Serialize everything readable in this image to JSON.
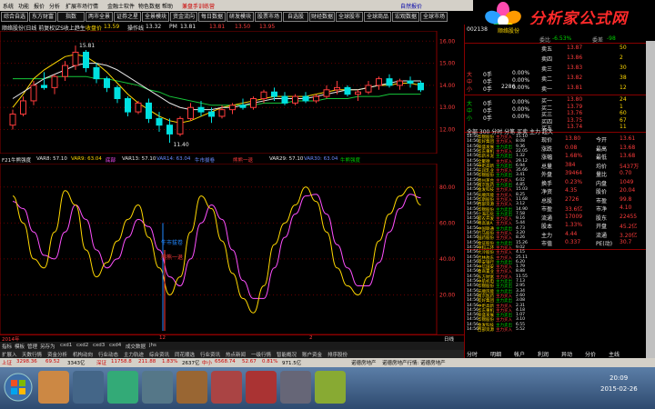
{
  "menu": [
    "系统",
    "功能",
    "报价",
    "分析",
    "扩展市场行情",
    "金融士软件",
    "物色数据",
    "帮助",
    "兼盘手训练营",
    "自然报价"
  ],
  "toolbar": [
    "综合自选",
    "东方财富",
    "指数",
    "两市全景",
    "证券之星",
    "全景模块",
    "资金流向",
    "每日数据",
    "研发模块",
    "股票市场",
    "自选股",
    "财经数据",
    "全球股市",
    "全球商品",
    "宏观数据",
    "全球市场"
  ],
  "stock": {
    "name": "顺络股份(日线 前复权)",
    "ma_label": "ZS收上趋生",
    "close_label": "收盘价",
    "close_val": "13.59",
    "ma2_label": "操作线",
    "ma2_val": "13.32",
    "pm_label": "PM",
    "pm_val": "13.81",
    "ma3_val": "13.81",
    "ma4_val": "13.50",
    "ma5_val": "13.95"
  },
  "main_axis": [
    "16.00",
    "15.00",
    "14.00",
    "13.00",
    "12.00"
  ],
  "annotations": {
    "high": "15.81",
    "low": "11.40"
  },
  "indicator": {
    "name": "F21牛熊强度",
    "v1": "VAR8: 57.10",
    "v2": "VAR9: 63.04",
    "v3": "底部",
    "v4": "VAR13: 57.10",
    "v5": "VAR14: 63.04",
    "v6": "牛市拔卷",
    "v7": "熊熊一退",
    "v8": "VAR29: 57.10",
    "v9": "VAR30: 63.04",
    "v10": "牛熊强度"
  },
  "sub_axis": [
    "80.00",
    "60.00",
    "40.00",
    "20.00"
  ],
  "sub_labels": {
    "a": "牛市拔卷",
    "b": "熊熊一退"
  },
  "datebar": {
    "left": "2014年",
    "m1": "12",
    "m2": "2",
    "right": "日线"
  },
  "tabs1": [
    "指标",
    "模板",
    "管理",
    "另存为",
    "cxd1",
    "cxd2",
    "cxd3",
    "cxd4",
    "成交数据",
    "jhs"
  ],
  "tabs2": [
    "扩展入",
    "天数行情",
    "资金分析",
    "机构动向",
    "行业动态",
    "主力轨迹",
    "综合资讯",
    "同花顺选",
    "行业资讯",
    "热点新闻",
    "一级行情",
    "智能概况",
    "账户资金",
    "排序股份"
  ],
  "rp": {
    "title": "顺络股份",
    "code": "002138",
    "committee": "委比",
    "committee_v": "-6.53%",
    "committee_diff": "委差",
    "committee_dv": "-98",
    "sell": [
      [
        "卖五",
        "13.87",
        "50"
      ],
      [
        "卖四",
        "13.86",
        "2"
      ],
      [
        "卖三",
        "13.83",
        "30"
      ],
      [
        "卖二",
        "13.82",
        "38"
      ],
      [
        "卖一",
        "13.81",
        "12"
      ]
    ],
    "buy": [
      [
        "买一",
        "13.80",
        "24"
      ],
      [
        "买二",
        "13.79",
        "1"
      ],
      [
        "买三",
        "13.76",
        "60"
      ],
      [
        "买四",
        "13.75",
        "67"
      ],
      [
        "买五",
        "13.74",
        "11"
      ]
    ],
    "mid": [
      [
        "大",
        "0手",
        "0.00%"
      ],
      [
        "中",
        "0手",
        "0.00%"
      ],
      [
        "小",
        "0手",
        "0.00%"
      ]
    ],
    "mid2": [
      [
        "大",
        "0手",
        "0.00%"
      ],
      [
        "中",
        "0手",
        "0.00%"
      ],
      [
        "小",
        "0手",
        "0.00%"
      ]
    ],
    "mid_extra": "2286",
    "stats_left": [
      [
        "现价",
        "13.80"
      ],
      [
        "涨跌",
        "0.08"
      ],
      [
        "涨幅",
        "1.68%"
      ],
      [
        "总量",
        "384"
      ],
      [
        "外盘",
        "39464"
      ],
      [
        "换手",
        "0.23%"
      ],
      [
        "净资",
        "4.35"
      ],
      [
        "总股",
        "2726"
      ],
      [
        "市盈",
        "33.6亿"
      ],
      [
        "流通",
        "17009"
      ],
      [
        "股本",
        "1.33%"
      ],
      [
        "主力",
        "4.44"
      ],
      [
        "市值",
        "0.337"
      ]
    ],
    "stats_right": [
      [
        "今开",
        "13.61"
      ],
      [
        "最高",
        "13.68"
      ],
      [
        "最低",
        "13.68"
      ],
      [
        "均价",
        "5437万"
      ],
      [
        "量比",
        "0.70"
      ],
      [
        "内盘",
        "1049"
      ],
      [
        "股价",
        "20.04"
      ],
      [
        "市盈",
        "99.8"
      ],
      [
        "市净",
        "4.10"
      ],
      [
        "股东",
        "22455"
      ],
      [
        "开盘",
        "45.2亿"
      ],
      [
        "流通",
        "3.20亿"
      ],
      [
        "PE(动)",
        "30.7"
      ]
    ],
    "ticks_head": "全部 300 分时 分笔 买卖 主力 超大",
    "ticks": [
      [
        "14:56",
        "华锦股份",
        "主力买入",
        "15.10"
      ],
      [
        "14:56",
        "友好集团",
        "主力买入",
        "8.08"
      ],
      [
        "14:56",
        "荣盛发展",
        "主力卖出",
        "9.36"
      ],
      [
        "14:56",
        "华东重机",
        "主力买入",
        "22.05"
      ],
      [
        "14:56",
        "华新水泥",
        "主力卖出",
        "1.32"
      ],
      [
        "14:56",
        "全聚德",
        "主力买入",
        "29.12"
      ],
      [
        "14:56",
        "中炬高新",
        "主力卖出",
        "6.94"
      ],
      [
        "14:56",
        "天润乳业",
        "主力买入",
        "35.66"
      ],
      [
        "14:56",
        "华锦股份",
        "主力卖出",
        "3.41"
      ],
      [
        "14:56",
        "贵州茅台",
        "主力买入",
        "6.02"
      ],
      [
        "14:56",
        "南京医药",
        "主力卖出",
        "4.85"
      ],
      [
        "14:56",
        "金发科技",
        "主力买入",
        "15.03"
      ],
      [
        "14:56",
        "天顺风能",
        "主力买入",
        "8.25"
      ],
      [
        "14:56",
        "华斯股份",
        "主力买入",
        "11.68"
      ],
      [
        "14:56",
        "西部资源",
        "主力买入",
        "3.12"
      ],
      [
        "14:56",
        "华锦股份",
        "主力卖出",
        "14.90"
      ],
      [
        "14:56",
        "上海石化",
        "主力卖出",
        "7.58"
      ],
      [
        "14:56",
        "新农开发",
        "主力买入",
        "9.16"
      ],
      [
        "14:56",
        "粤高速A",
        "主力买入",
        "5.44"
      ],
      [
        "14:56",
        "中国联通",
        "主力卖出",
        "4.73"
      ],
      [
        "14:56",
        "万马股份",
        "主力买入",
        "3.20"
      ],
      [
        "14:56",
        "国药股份",
        "主力买入",
        "8.26"
      ],
      [
        "14:56",
        "金证股份",
        "主力卖出",
        "15.26"
      ],
      [
        "14:56",
        "中科三环",
        "主力买入",
        "9.02"
      ],
      [
        "14:56",
        "大冷股份",
        "主力买入",
        "4.15"
      ],
      [
        "14:56",
        "吉林敖东",
        "主力买入",
        "25.11"
      ],
      [
        "14:56",
        "平安银行",
        "主力卖出",
        "6.20"
      ],
      [
        "14:56",
        "中信国安",
        "主力买入",
        "1.79"
      ],
      [
        "14:56",
        "鲁商置业",
        "主力买入",
        "8.88"
      ],
      [
        "14:56",
        "东方财富",
        "主力买入",
        "11.55"
      ],
      [
        "14:56",
        "中航机电",
        "主力卖出",
        "7.13"
      ],
      [
        "14:56",
        "华锦股份",
        "主力卖出",
        "2.95"
      ],
      [
        "14:56",
        "天顺风能",
        "主力卖出",
        "3.34"
      ],
      [
        "14:56",
        "南京医药",
        "主力买入",
        "2.60"
      ],
      [
        "14:56",
        "友好集团",
        "主力卖出",
        "3.08"
      ],
      [
        "14:56",
        "中炬高新",
        "主力买入",
        "2.31"
      ],
      [
        "14:56",
        "华东重机",
        "主力买入",
        "4.18"
      ],
      [
        "14:56",
        "荣盛发展",
        "主力卖出",
        "1.07"
      ],
      [
        "14:56",
        "华锦股份",
        "主力买入",
        "3.10"
      ],
      [
        "14:56",
        "金发科技",
        "主力卖出",
        "6.55"
      ],
      [
        "14:56",
        "西部资源",
        "主力买入",
        "5.52"
      ]
    ],
    "bottom": [
      "分时",
      "明细",
      "帐户",
      "利润",
      "异动",
      "分价",
      "主线"
    ]
  },
  "status": {
    "sh_label": "上证",
    "sh_val": "3298.36",
    "sh_chg": "69.52",
    "sh_pct": "3343亿",
    "sz_label": "深证",
    "sz_val": "11758.8",
    "sz_chg": "211.88",
    "sz_pct": "1.83%",
    "sz_amt": "2637亿",
    "zx_label": "中小",
    "zx_val": "6568.74",
    "zx_chg": "52.67",
    "zx_pct": "0.81%",
    "zx_amt": "971.5亿",
    "msg1": "诺德房地产",
    "msg2": "诺德房地产行情: 诺德房地产"
  },
  "clock": {
    "time": "20:09",
    "date": "2015-02-26"
  },
  "colors": {
    "up": "#ff3c3c",
    "down": "#00d000",
    "line_yellow": "#ffd800",
    "line_white": "#e8e8e8",
    "line_mag": "#ff50ff",
    "line_green": "#16c83a",
    "line_blue": "#2288ff"
  },
  "chart_data": {
    "type": "line",
    "candles": [
      [
        12.2,
        12.9,
        12.0,
        12.7
      ],
      [
        12.7,
        13.5,
        12.6,
        13.3
      ],
      [
        13.3,
        14.2,
        13.1,
        14.0
      ],
      [
        14.0,
        14.6,
        13.8,
        13.9
      ],
      [
        13.9,
        14.5,
        13.6,
        14.4
      ],
      [
        14.4,
        15.1,
        14.2,
        14.9
      ],
      [
        14.9,
        15.8,
        14.7,
        15.5
      ],
      [
        15.5,
        15.6,
        14.6,
        14.8
      ],
      [
        14.8,
        15.0,
        14.1,
        14.3
      ],
      [
        14.3,
        14.4,
        13.7,
        13.9
      ],
      [
        13.9,
        14.0,
        13.2,
        13.4
      ],
      [
        13.4,
        13.5,
        12.6,
        12.8
      ],
      [
        12.8,
        13.3,
        12.7,
        13.2
      ],
      [
        13.2,
        13.4,
        12.3,
        12.5
      ],
      [
        12.5,
        12.8,
        11.9,
        12.2
      ],
      [
        12.2,
        12.5,
        11.4,
        11.8
      ],
      [
        11.8,
        12.6,
        11.7,
        12.5
      ],
      [
        12.5,
        13.2,
        12.4,
        13.0
      ],
      [
        13.0,
        13.3,
        12.6,
        12.8
      ],
      [
        12.8,
        13.0,
        12.3,
        12.6
      ],
      [
        12.6,
        13.1,
        12.5,
        12.9
      ],
      [
        12.9,
        13.2,
        12.7,
        13.1
      ],
      [
        13.1,
        13.4,
        12.9,
        13.0
      ],
      [
        13.0,
        13.5,
        12.9,
        13.4
      ],
      [
        13.4,
        13.8,
        13.2,
        13.7
      ],
      [
        13.7,
        13.9,
        13.3,
        13.5
      ],
      [
        13.5,
        13.7,
        13.1,
        13.2
      ],
      [
        13.2,
        13.6,
        13.1,
        13.5
      ],
      [
        13.5,
        13.7,
        13.2,
        13.3
      ],
      [
        13.3,
        13.6,
        13.2,
        13.5
      ],
      [
        13.5,
        14.0,
        13.4,
        13.8
      ],
      [
        13.8,
        14.2,
        13.6,
        13.9
      ],
      [
        13.9,
        14.0,
        13.5,
        13.6
      ],
      [
        13.6,
        13.8,
        13.3,
        13.7
      ],
      [
        13.7,
        14.2,
        13.6,
        14.0
      ],
      [
        14.0,
        14.4,
        13.8,
        14.3
      ],
      [
        14.3,
        14.5,
        13.9,
        14.0
      ],
      [
        14.0,
        14.3,
        13.8,
        14.2
      ],
      [
        14.2,
        14.4,
        13.9,
        14.1
      ],
      [
        14.1,
        14.2,
        13.7,
        13.8
      ]
    ],
    "yellow_line": [
      13.0,
      13.6,
      14.3,
      14.7,
      15.0,
      15.3,
      15.4,
      15.3,
      15.0,
      14.6,
      14.1,
      13.6,
      13.2,
      12.9,
      12.6,
      12.4,
      12.3,
      12.4,
      12.6,
      12.8,
      13.0,
      13.1,
      13.2,
      13.3,
      13.4,
      13.5,
      13.5,
      13.5,
      13.5,
      13.6,
      13.7,
      13.8,
      13.8,
      13.8,
      13.9,
      14.0,
      14.0,
      14.1,
      14.1,
      14.0
    ],
    "white_line": [
      13.4,
      13.7,
      14.0,
      14.3,
      14.5,
      14.7,
      14.9,
      15.0,
      15.0,
      14.9,
      14.7,
      14.4,
      14.1,
      13.8,
      13.5,
      13.2,
      13.0,
      12.9,
      12.9,
      12.9,
      13.0,
      13.0,
      13.1,
      13.2,
      13.3,
      13.4,
      13.4,
      13.4,
      13.4,
      13.5,
      13.6,
      13.7,
      13.8,
      13.8,
      13.9,
      14.0,
      14.1,
      14.2,
      14.2,
      14.2
    ],
    "green_line": [
      14.3,
      14.3,
      14.3,
      14.3,
      14.4,
      14.4,
      14.4,
      14.4,
      14.3,
      14.3,
      14.2,
      14.1,
      14.0,
      13.8,
      13.7,
      13.5,
      13.4,
      13.3,
      13.2,
      13.1,
      13.1,
      13.1,
      13.1,
      13.1,
      13.2,
      13.2,
      13.2,
      13.3,
      13.3,
      13.3,
      13.4,
      13.4,
      13.4,
      13.5,
      13.5,
      13.5,
      13.6,
      13.6,
      13.6,
      13.6
    ],
    "ylim": [
      11.2,
      16.3
    ],
    "osc_white": [
      75,
      60,
      40,
      35,
      55,
      78,
      70,
      45,
      30,
      38,
      50,
      62,
      70,
      52,
      35,
      20,
      30,
      55,
      75,
      68,
      50,
      32,
      18,
      10,
      25,
      48,
      60,
      70,
      80,
      72,
      55,
      35,
      25,
      20,
      30,
      50,
      65,
      75,
      80,
      70
    ],
    "osc_mag": [
      72,
      68,
      55,
      42,
      40,
      55,
      70,
      62,
      45,
      35,
      40,
      52,
      62,
      58,
      45,
      30,
      25,
      40,
      60,
      70,
      62,
      45,
      28,
      18,
      18,
      35,
      52,
      65,
      75,
      76,
      65,
      48,
      35,
      25,
      25,
      38,
      55,
      68,
      76,
      74
    ],
    "osc_ylim": [
      0,
      90
    ]
  }
}
